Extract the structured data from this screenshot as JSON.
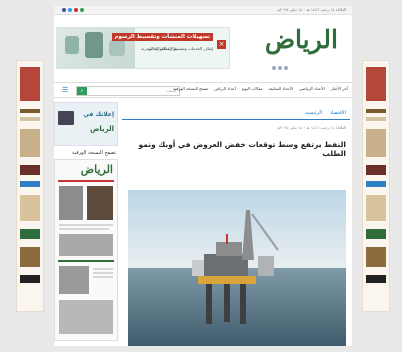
{
  "topbar": {
    "date": "الثلاثاء ١٤ رجب ١٤٤٦ هـ - ١٤ يناير ٢٠٢٥م",
    "social_colors": [
      "#3b5998",
      "#1da1f2",
      "#c4302b",
      "#2e9e5b"
    ]
  },
  "brand": {
    "logo": "الرياض",
    "color": "#2f6e3b"
  },
  "ad_banner": {
    "headline": "تسهيلات المنشآت وتقسيط الرسوم",
    "sub": "إيقاف الخدمات وتقسيط المقابل المالي",
    "brand": "وزارة الموارد البشرية",
    "close": "×"
  },
  "nav": {
    "items": [
      "آخر الأخبار",
      "الأعداد الرياضي",
      "الأعداد السابقة",
      "مقالات اليوم",
      "أعداد الرياض",
      "تصفح النسخة الورقية"
    ],
    "search_placeholder": "البحث",
    "search_icon": "search-icon",
    "menu_icon": "menu-icon"
  },
  "sidebar": {
    "ad_line1": "إعلانك في",
    "ad_line2": "الرياض",
    "print_label": "تصفح النسخة الورقية",
    "paper_masthead": "الرياض"
  },
  "article": {
    "breadcrumbs": [
      "الرئيسية",
      "الاقتصاد"
    ],
    "meta": "الثلاثاء ١٤ رجب ١٤٤٦ هـ - ١٤ يناير ٢٠٢٥م",
    "title": "النفط يرتفع وسط توقعات خفض العروض في أوبك ونمو الطلب",
    "image_alt": "منصة نفط بحرية"
  },
  "colors": {
    "accent": "#2e7fc4",
    "green": "#2e9e5b",
    "red": "#c0392b"
  }
}
